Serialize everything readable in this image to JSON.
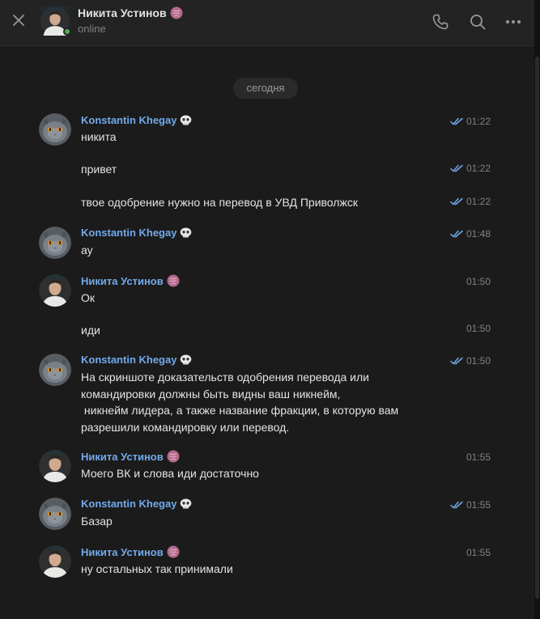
{
  "header": {
    "contact_name": "Никита Устинов",
    "status": "online",
    "actions": [
      "phone-icon",
      "search-icon",
      "more-icon"
    ]
  },
  "date_divider": "сегодня",
  "messages": [
    {
      "sender": "Konstantin Khegay",
      "text": "никита",
      "time": "01:22",
      "read": true
    },
    {
      "sender": "",
      "text": "привет",
      "time": "01:22",
      "read": true
    },
    {
      "sender": "",
      "text": "твое одобрение нужно на перевод в УВД Приволжск",
      "time": "01:22",
      "read": true
    },
    {
      "sender": "Konstantin Khegay",
      "text": "ау",
      "time": "01:48",
      "read": true
    },
    {
      "sender": "Никита Устинов",
      "text": "Ок",
      "time": "01:50",
      "read": false
    },
    {
      "sender": "",
      "text": "иди",
      "time": "01:50",
      "read": false
    },
    {
      "sender": "Konstantin Khegay",
      "text_lines": [
        "На скриншоте доказательств одобрения перевода или",
        "командировки должны быть видны ваш никнейм,",
        " никнейм лидера, а также название фракции, в которую вам",
        "разрешили командировку или перевод."
      ],
      "time": "01:50",
      "read": true
    },
    {
      "sender": "Никита Устинов",
      "text": "Моего ВК и слова иди достаточно",
      "time": "01:55",
      "read": false
    },
    {
      "sender": "Konstantin Khegay",
      "text": "Базар",
      "time": "01:55",
      "read": true
    },
    {
      "sender": "Никита Устинов",
      "text": "ну остальных так принимали",
      "time": "01:55",
      "read": false
    }
  ],
  "colors": {
    "background": "#1b1b1b",
    "header": "#232323",
    "sender_name": "#71aaeb",
    "read_check": "#71aaeb",
    "online": "#4bb34b"
  }
}
